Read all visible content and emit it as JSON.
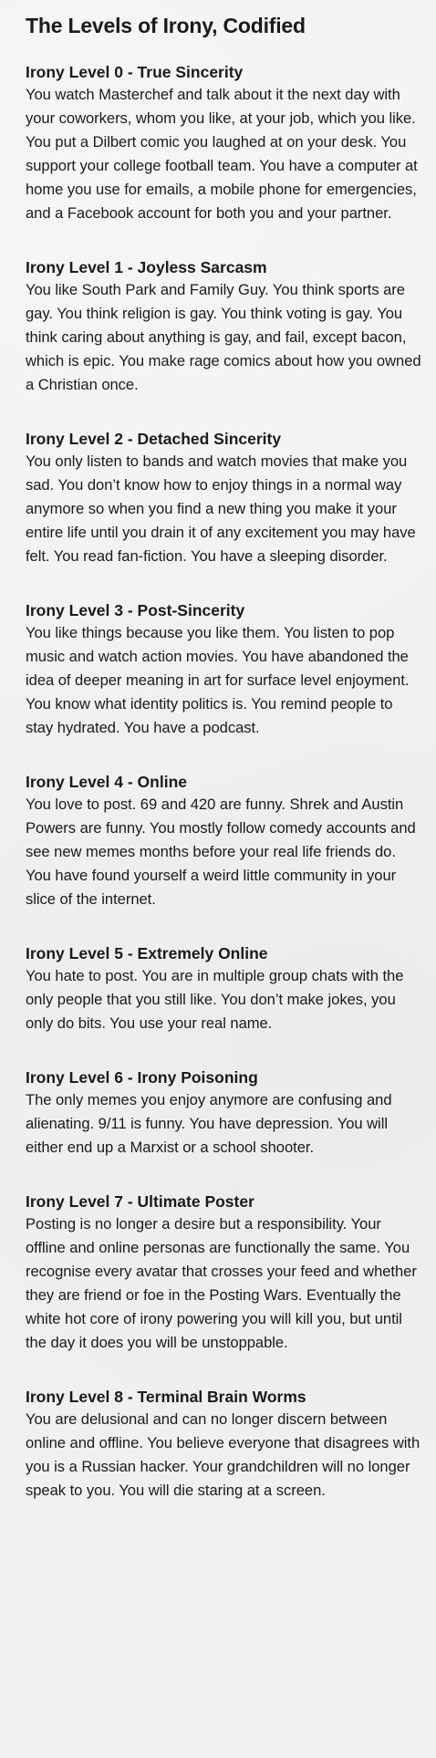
{
  "title": "The Levels of Irony, Codified",
  "levels": [
    {
      "heading": "Irony Level 0 - True Sincerity",
      "body": "You watch Masterchef and talk about it the next day with your coworkers, whom you like, at your job, which you like. You put a Dilbert comic you laughed at on your desk. You support your college football team. You have a computer at home you use for emails, a mobile phone for emergencies, and a Facebook account for both you and your partner."
    },
    {
      "heading": "Irony Level 1 - Joyless Sarcasm",
      "body": "You like South Park and Family Guy. You think sports are gay. You think religion is gay. You think voting is gay. You think caring about anything is gay, and fail, except bacon, which is epic. You make rage comics about how you owned a Christian once."
    },
    {
      "heading": "Irony Level 2 - Detached Sincerity",
      "body": "You only listen to bands and watch movies that make you sad. You don’t know how to enjoy things in a normal way anymore so when you find a new thing you make it your entire life until you drain it of any excitement you may have felt. You read fan-fiction. You have a sleeping disorder."
    },
    {
      "heading": "Irony Level 3 - Post-Sincerity",
      "body": "You like things because you like them. You listen to pop music and watch action movies. You have abandoned the idea of deeper meaning in art for surface level enjoyment. You know what identity politics is. You remind people to stay hydrated. You have a podcast."
    },
    {
      "heading": "Irony Level 4 - Online",
      "body": "You love to post. 69 and 420 are funny. Shrek and Austin Powers are funny. You mostly follow comedy accounts and see new memes months before your real life friends do. You have found yourself a weird little community in your slice of the internet."
    },
    {
      "heading": "Irony Level 5 - Extremely Online",
      "body": "You hate to post. You are in multiple group chats with the only people that you still like. You don’t make jokes, you only do bits. You use your real name."
    },
    {
      "heading": "Irony Level 6 - Irony Poisoning",
      "body": "The only memes you enjoy anymore are confusing and alienating. 9/11 is funny. You have depression. You will either end up a Marxist or a school shooter."
    },
    {
      "heading": "Irony Level 7 - Ultimate Poster",
      "body": "Posting is no longer a desire but a responsibility. Your offline and online personas are functionally the same. You recognise every avatar that crosses your feed and whether they are friend or foe in the Posting Wars. Eventually the white hot core of irony powering you will kill you, but until the day it does you will be unstoppable."
    },
    {
      "heading": "Irony Level 8 - Terminal Brain Worms",
      "body": "You are delusional and can no longer discern between online and offline. You believe everyone that disagrees with you is a Russian hacker. Your grandchildren will no longer speak to you. You will die staring at a screen."
    }
  ]
}
